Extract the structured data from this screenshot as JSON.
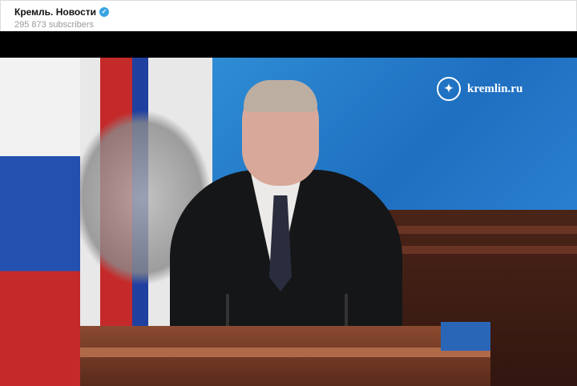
{
  "channel": {
    "name": "Кремль. Новости",
    "subscribers": "295 873 subscribers",
    "verified_icon": "verified-check-icon"
  },
  "video": {
    "watermark": "kremlin.ru",
    "accent": "#3aa3e3"
  }
}
